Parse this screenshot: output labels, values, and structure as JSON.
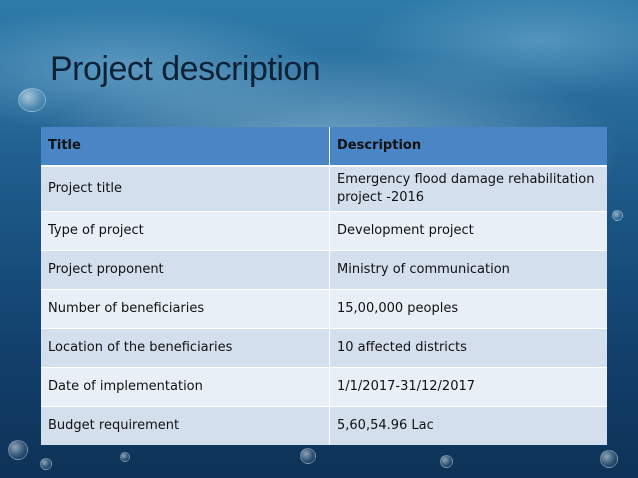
{
  "slide": {
    "title": "Project description"
  },
  "table": {
    "headers": [
      "Title",
      "Description"
    ],
    "rows": [
      {
        "label": "Project title",
        "value": "Emergency flood damage rehabilitation project -2016"
      },
      {
        "label": "Type of project",
        "value": "Development project"
      },
      {
        "label": "Project proponent",
        "value": "Ministry of communication"
      },
      {
        "label": "Number of beneficiaries",
        "value": "15,00,000 peoples"
      },
      {
        "label": "Location of the beneficiaries",
        "value": "10 affected districts"
      },
      {
        "label": "Date of implementation",
        "value": "1/1/2017-31/12/2017"
      },
      {
        "label": "Budget requirement",
        "value": "5,60,54.96 Lac"
      }
    ]
  },
  "colors": {
    "header_bg": "#4a86c6",
    "row_odd": "#d4dfee",
    "row_even": "#e9eff7",
    "title": "#0d2236"
  }
}
